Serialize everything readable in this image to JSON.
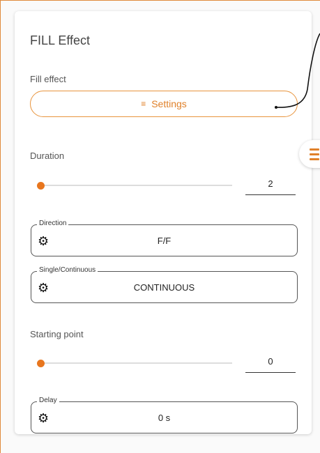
{
  "card": {
    "title": "FILL Effect",
    "fill_effect_label": "Fill effect",
    "settings_button": "Settings",
    "duration_label": "Duration",
    "duration_value": "2",
    "duration_slider_fraction": 0,
    "direction": {
      "legend": "Direction",
      "value": "F/F"
    },
    "mode": {
      "legend": "Single/Continuous",
      "value": "CONTINUOUS"
    },
    "starting_point_label": "Starting point",
    "starting_point_value": "0",
    "starting_point_slider_fraction": 0,
    "delay": {
      "legend": "Delay",
      "value": "0 s"
    }
  },
  "colors": {
    "accent": "#e8761e",
    "border": "#555555"
  },
  "icons": [
    "sliders-icon",
    "gear-icon",
    "hamburger-menu-icon"
  ]
}
